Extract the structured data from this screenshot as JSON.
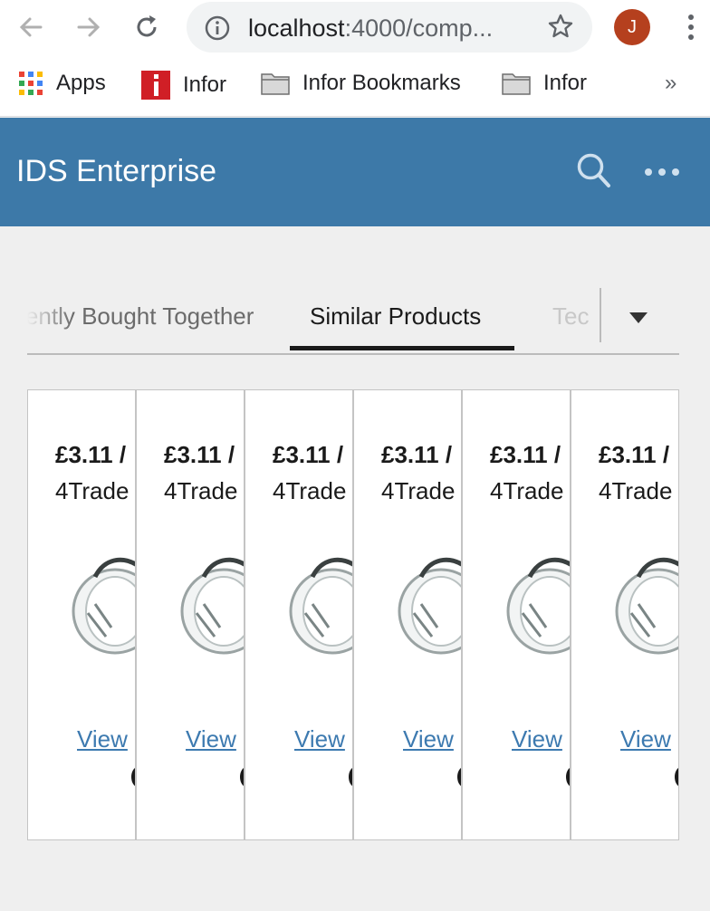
{
  "browser": {
    "url_host": "localhost",
    "url_rest": ":4000/comp...",
    "avatar_initial": "J",
    "bookmarks": [
      {
        "label": "Apps",
        "icon": "apps-grid-icon"
      },
      {
        "label": "Infor",
        "icon": "infor-icon"
      },
      {
        "label": "Infor Bookmarks",
        "icon": "folder-icon"
      },
      {
        "label": "Infor",
        "icon": "folder-icon"
      }
    ],
    "more_bookmarks": "»"
  },
  "header": {
    "title": "IDS Enterprise",
    "color": "#3d79a8"
  },
  "tabs": {
    "left_partial": "Frequently Bought Together",
    "active": "Similar Products",
    "right_partial": "Technical"
  },
  "products": [
    {
      "price": "£3.11 /",
      "brand": "4Trade",
      "link": "View"
    },
    {
      "price": "£3.11 /",
      "brand": "4Trade",
      "link": "View"
    },
    {
      "price": "£3.11 /",
      "brand": "4Trade",
      "link": "View"
    },
    {
      "price": "£3.11 /",
      "brand": "4Trade",
      "link": "View"
    },
    {
      "price": "£3.11 /",
      "brand": "4Trade",
      "link": "View"
    },
    {
      "price": "£3.11 /",
      "brand": "4Trade",
      "link": "View"
    }
  ]
}
